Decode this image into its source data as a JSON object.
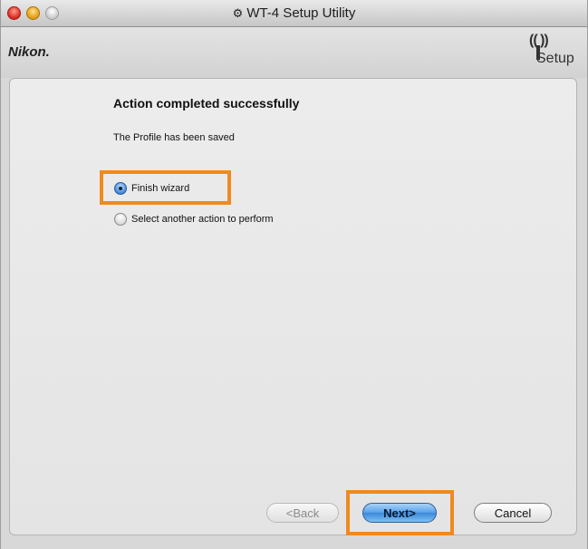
{
  "window": {
    "title": "WT-4 Setup Utility",
    "title_icon": "app-icon"
  },
  "header": {
    "brand": "Nikon.",
    "logo_text": "Setup",
    "logo_icon": "wireless-tower-icon"
  },
  "content": {
    "heading": "Action completed successfully",
    "message": "The Profile has been saved",
    "options": [
      {
        "label": "Finish wizard",
        "selected": true
      },
      {
        "label": "Select another action to perform",
        "selected": false
      }
    ]
  },
  "buttons": {
    "back": "<Back",
    "next": "Next>",
    "cancel": "Cancel"
  },
  "colors": {
    "highlight": "#f08a1c",
    "default_button": "#3c87d8"
  }
}
